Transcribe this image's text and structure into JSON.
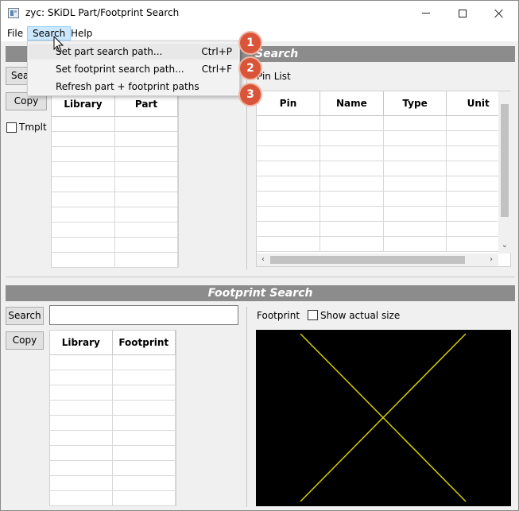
{
  "window": {
    "title": "zyc: SKiDL Part/Footprint Search",
    "minimize_icon": "minimize-icon",
    "maximize_icon": "maximize-icon",
    "close_icon": "close-icon"
  },
  "menubar": {
    "file": "File",
    "search": "Search",
    "help": "Help"
  },
  "search_menu": {
    "items": [
      {
        "label": "Set part search path...",
        "shortcut": "Ctrl+P"
      },
      {
        "label": "Set footprint search path...",
        "shortcut": "Ctrl+F"
      },
      {
        "label": "Refresh part + footprint paths",
        "shortcut": ""
      }
    ]
  },
  "callouts": [
    "1",
    "2",
    "3"
  ],
  "part_search": {
    "header": "Search",
    "search_button_partial": "Sear",
    "copy_button": "Copy",
    "template_label": "Tmplt",
    "columns": [
      "Library",
      "Part"
    ],
    "row_count": 10
  },
  "pin_list": {
    "label": "Pin List",
    "columns": [
      "Pin",
      "Name",
      "Type",
      "Unit"
    ],
    "row_count": 9
  },
  "footprint_search": {
    "header": "Footprint Search",
    "search_button": "Search",
    "copy_button": "Copy",
    "columns": [
      "Library",
      "Footprint"
    ],
    "row_count": 10,
    "preview_label": "Footprint",
    "show_actual_size": "Show actual size",
    "preview_line_color": "#d4cc00"
  }
}
